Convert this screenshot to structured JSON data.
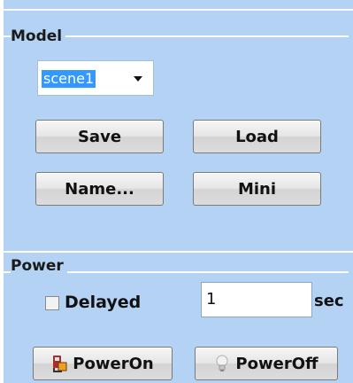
{
  "model": {
    "title": "Model",
    "scene_select": {
      "value": "scene1"
    },
    "buttons": {
      "save": "Save",
      "load": "Load",
      "name": "Name...",
      "mini": "Mini"
    }
  },
  "power": {
    "title": "Power",
    "delayed": {
      "label": "Delayed",
      "checked": false
    },
    "delay_value": "1",
    "unit": "sec",
    "buttons": {
      "on": "PowerOn",
      "off": "PowerOff"
    }
  },
  "icons": {
    "power_on": "power-plug-icon",
    "power_off": "light-bulb-icon"
  },
  "colors": {
    "panel_bg": "#b3d2f4",
    "selection": "#3399ff"
  }
}
